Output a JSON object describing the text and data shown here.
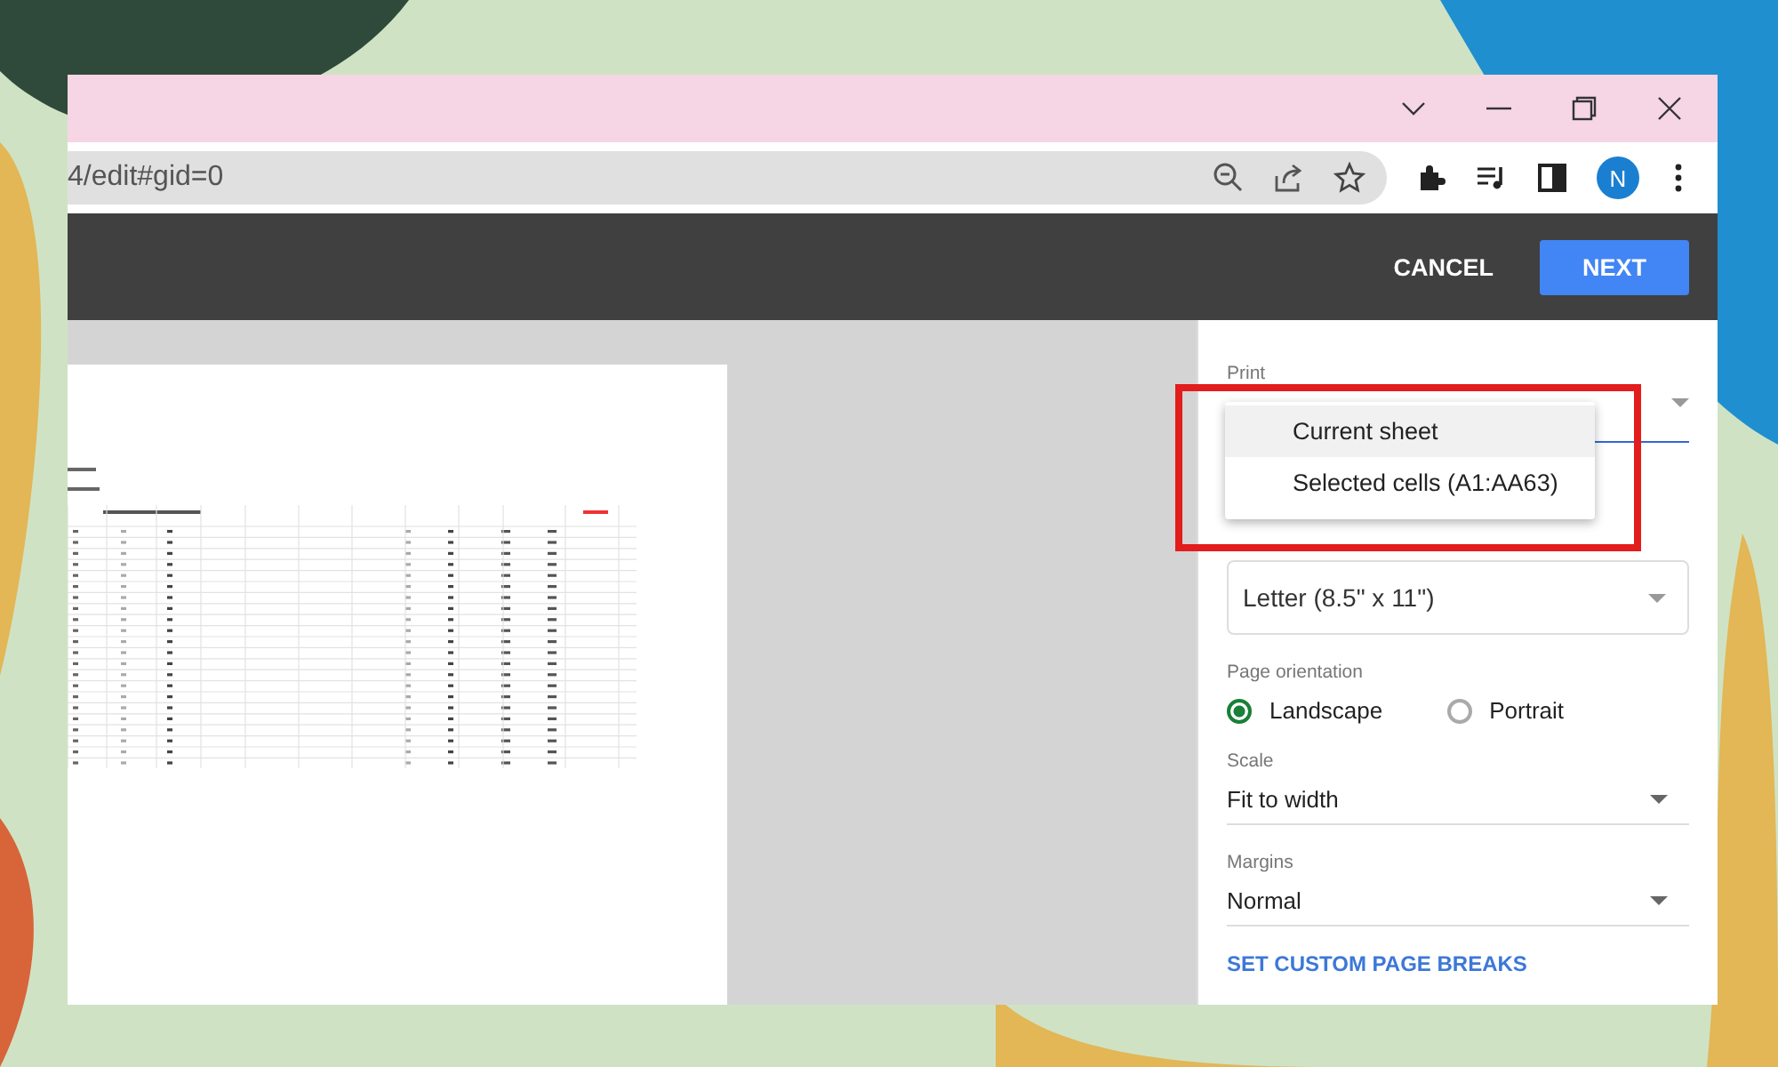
{
  "address_bar": {
    "url": "4/edit#gid=0"
  },
  "profile": {
    "initial": "N"
  },
  "toolbar": {
    "buttons": [
      {
        "label": "CANCEL",
        "kind": "text"
      },
      {
        "label": "NEXT",
        "kind": "primary"
      }
    ]
  },
  "print_panel": {
    "print_label": "Print",
    "print_menu": [
      {
        "label": "Current sheet",
        "selected": true
      },
      {
        "label": "Selected cells (A1:AA63)",
        "selected": false
      }
    ],
    "paper_size": "Letter (8.5\" x 11\")",
    "orientation_label": "Page orientation",
    "orientation_options": [
      {
        "label": "Landscape",
        "selected": true
      },
      {
        "label": "Portrait",
        "selected": false
      }
    ],
    "scale": {
      "label": "Scale",
      "value": "Fit to width"
    },
    "margins": {
      "label": "Margins",
      "value": "Normal"
    },
    "link": "SET CUSTOM PAGE BREAKS"
  }
}
